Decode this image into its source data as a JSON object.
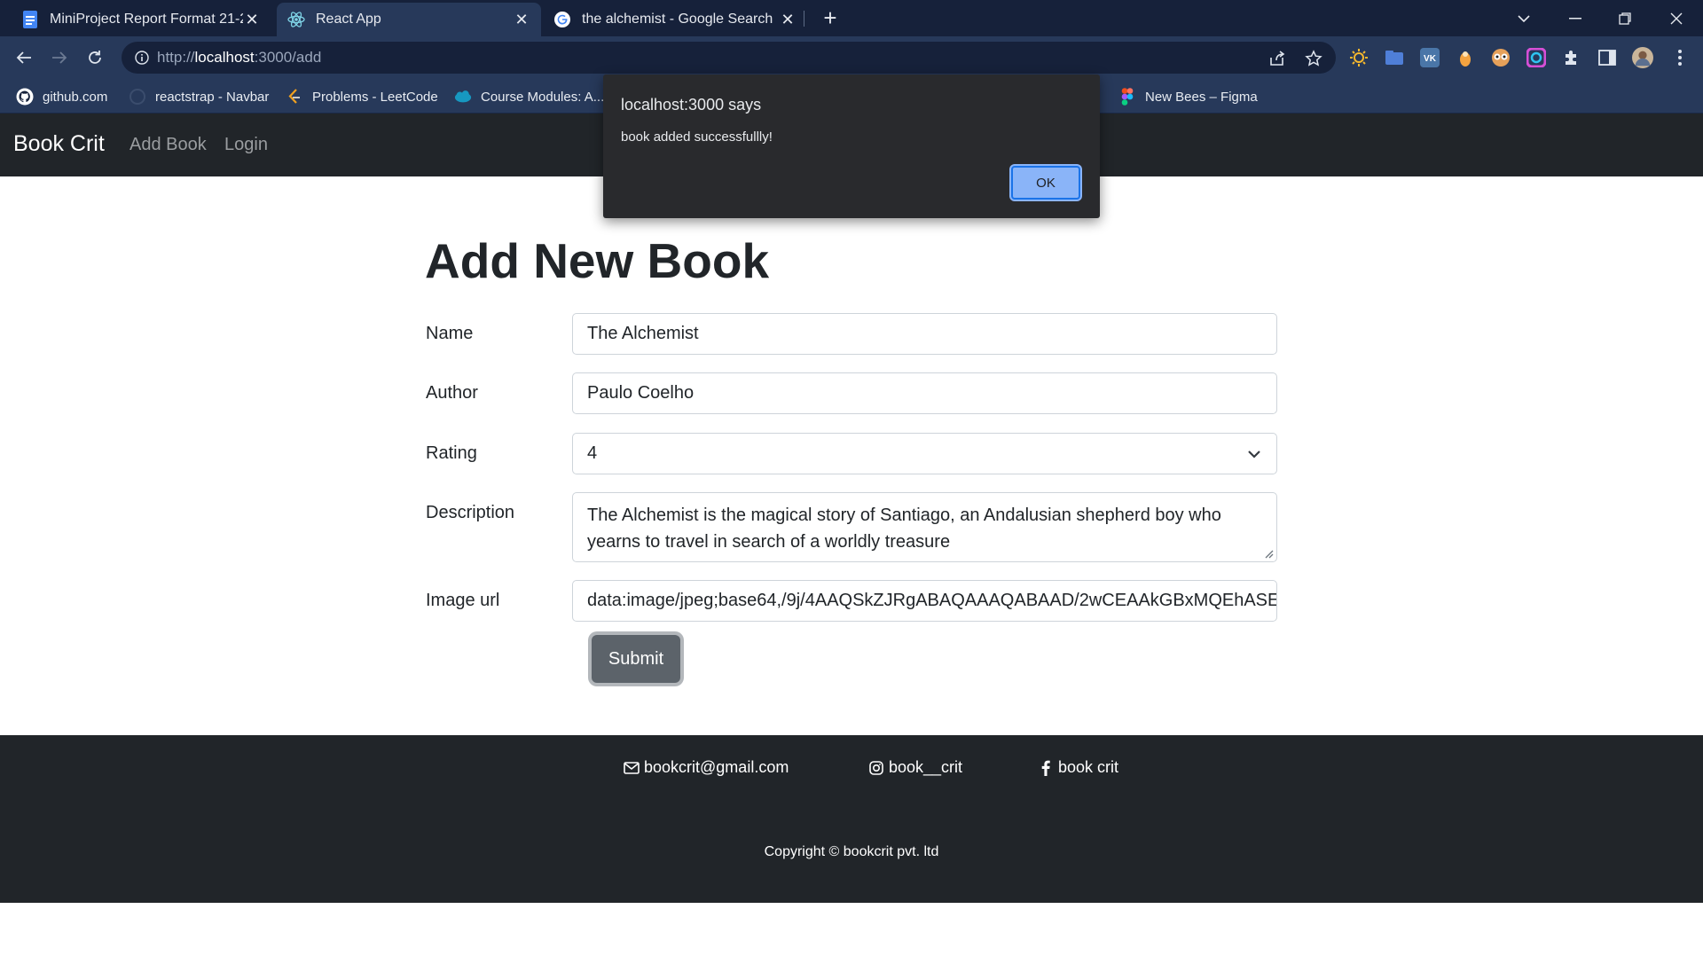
{
  "browser": {
    "tabs": [
      {
        "title": "MiniProject Report Format 21-22",
        "icon": "docs-icon"
      },
      {
        "title": "React App",
        "icon": "react-icon"
      },
      {
        "title": "the alchemist - Google Search",
        "icon": "google-icon"
      }
    ],
    "url_prefix": "http://",
    "url_host": "localhost",
    "url_rest": ":3000/add",
    "bookmarks": [
      {
        "label": "github.com",
        "icon": "github-icon"
      },
      {
        "label": "reactstrap - Navbar",
        "icon": "reactstrap-icon"
      },
      {
        "label": "Problems - LeetCode",
        "icon": "leetcode-icon"
      },
      {
        "label": "Course Modules: A...",
        "icon": "salesforce-icon"
      },
      {
        "label": "New Bees – Figma",
        "icon": "figma-icon"
      }
    ]
  },
  "navbar": {
    "brand": "Book Crit",
    "links": [
      "Add Book",
      "Login"
    ]
  },
  "form": {
    "title": "Add New Book",
    "name_label": "Name",
    "name_value": "The Alchemist",
    "author_label": "Author",
    "author_value": "Paulo Coelho",
    "rating_label": "Rating",
    "rating_value": "4",
    "description_label": "Description",
    "description_value": "The Alchemist is the magical story of Santiago, an Andalusian shepherd boy who yearns to travel in search of a worldly treasure",
    "image_label": "Image url",
    "image_value": "data:image/jpeg;base64,/9j/4AAQSkZJRgABAQAAAQABAAD/2wCEAAkGBxMQEhASEhM",
    "submit_label": "Submit"
  },
  "footer": {
    "email": "bookcrit@gmail.com",
    "instagram": "book__crit",
    "facebook": "book crit",
    "copyright": "Copyright © bookcrit pvt. ltd"
  },
  "alert": {
    "title": "localhost:3000 says",
    "message": "book added successfullly!",
    "ok_label": "OK"
  },
  "colors": {
    "chrome_dark": "#16213a",
    "chrome": "#27395a",
    "navbar": "#212529",
    "submit": "#5c636a",
    "alert_bg": "#292a2d",
    "alert_ok": "#8ab4f8"
  }
}
